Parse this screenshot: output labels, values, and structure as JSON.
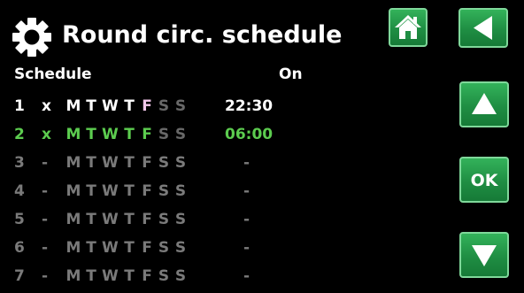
{
  "header": {
    "title": "Round circ. schedule",
    "icon": "gear-icon"
  },
  "columns": {
    "schedule": "Schedule",
    "on": "On"
  },
  "colors": {
    "bright": "#ffffff",
    "active_green": "#5ccc4f",
    "inactive": "#7a7a7a",
    "weekend_dim": "#686868",
    "friday_tint": "#f3c8ec",
    "button_green": "#23984a"
  },
  "schedule_rows": [
    {
      "num": "1",
      "active": "x",
      "days": [
        "M",
        "T",
        "W",
        "T",
        "F",
        "S",
        "S"
      ],
      "time": "22:30",
      "state": "enabled"
    },
    {
      "num": "2",
      "active": "x",
      "days": [
        "M",
        "T",
        "W",
        "T",
        "F",
        "S",
        "S"
      ],
      "time": "06:00",
      "state": "selected"
    },
    {
      "num": "3",
      "active": "-",
      "days": [
        "M",
        "T",
        "W",
        "T",
        "F",
        "S",
        "S"
      ],
      "time": "-",
      "state": "disabled"
    },
    {
      "num": "4",
      "active": "-",
      "days": [
        "M",
        "T",
        "W",
        "T",
        "F",
        "S",
        "S"
      ],
      "time": "-",
      "state": "disabled"
    },
    {
      "num": "5",
      "active": "-",
      "days": [
        "M",
        "T",
        "W",
        "T",
        "F",
        "S",
        "S"
      ],
      "time": "-",
      "state": "disabled"
    },
    {
      "num": "6",
      "active": "-",
      "days": [
        "M",
        "T",
        "W",
        "T",
        "F",
        "S",
        "S"
      ],
      "time": "-",
      "state": "disabled"
    },
    {
      "num": "7",
      "active": "-",
      "days": [
        "M",
        "T",
        "W",
        "T",
        "F",
        "S",
        "S"
      ],
      "time": "-",
      "state": "disabled"
    }
  ],
  "buttons": {
    "home": {
      "icon": "home-icon"
    },
    "back": {
      "icon": "back-arrow-icon"
    },
    "up": {
      "icon": "up-arrow-icon"
    },
    "ok": {
      "label": "OK"
    },
    "down": {
      "icon": "down-arrow-icon"
    }
  }
}
